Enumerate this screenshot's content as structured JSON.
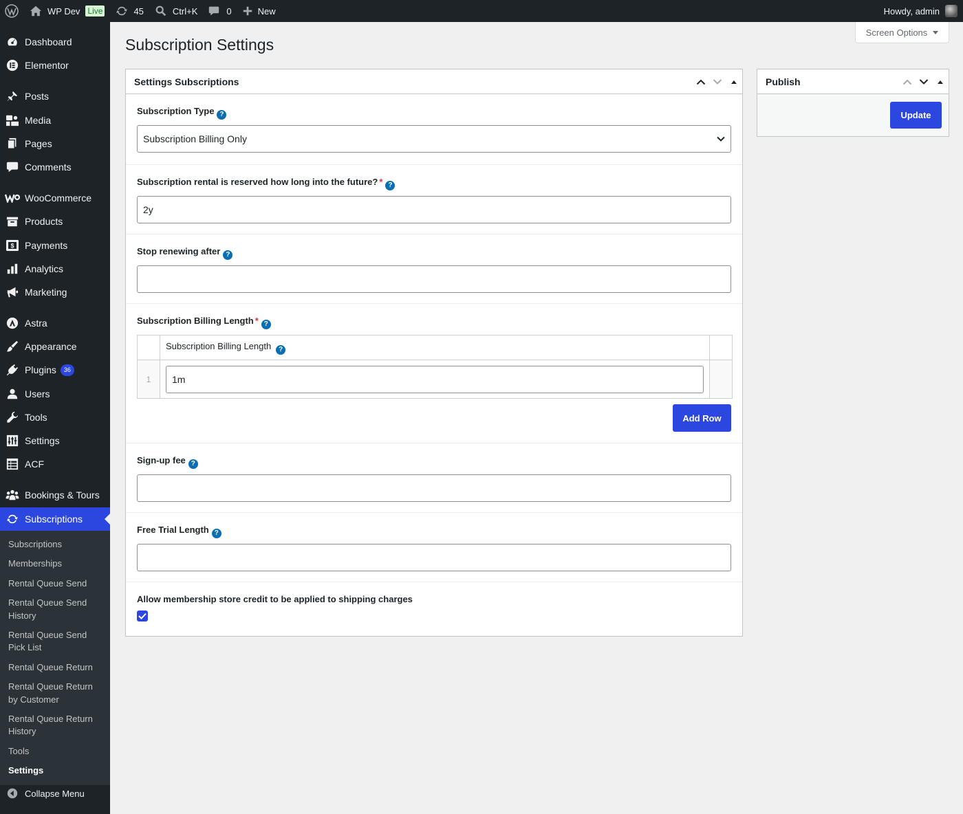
{
  "admin_bar": {
    "site_name": "WP Dev",
    "live_badge": "Live",
    "updates_count": "45",
    "search_shortcut": "Ctrl+K",
    "comments_count": "0",
    "new_label": "New",
    "greeting": "Howdy, admin"
  },
  "sidebar": {
    "items": [
      {
        "label": "Dashboard",
        "icon": "dashboard-icon"
      },
      {
        "label": "Elementor",
        "icon": "elementor-icon"
      },
      {
        "label": "Posts",
        "icon": "pin-icon"
      },
      {
        "label": "Media",
        "icon": "media-icon"
      },
      {
        "label": "Pages",
        "icon": "pages-icon"
      },
      {
        "label": "Comments",
        "icon": "comment-icon"
      },
      {
        "label": "WooCommerce",
        "icon": "woocommerce-icon"
      },
      {
        "label": "Products",
        "icon": "archive-icon"
      },
      {
        "label": "Payments",
        "icon": "payments-icon"
      },
      {
        "label": "Analytics",
        "icon": "bar-chart-icon"
      },
      {
        "label": "Marketing",
        "icon": "megaphone-icon"
      },
      {
        "label": "Astra",
        "icon": "astra-icon"
      },
      {
        "label": "Appearance",
        "icon": "brush-icon"
      },
      {
        "label": "Plugins",
        "icon": "plug-icon",
        "badge": "36"
      },
      {
        "label": "Users",
        "icon": "user-icon"
      },
      {
        "label": "Tools",
        "icon": "wrench-icon"
      },
      {
        "label": "Settings",
        "icon": "sliders-icon"
      },
      {
        "label": "ACF",
        "icon": "grid-icon"
      },
      {
        "label": "Bookings & Tours",
        "icon": "groups-icon"
      },
      {
        "label": "Subscriptions",
        "icon": "update-icon"
      }
    ],
    "submenu": [
      "Subscriptions",
      "Memberships",
      "Rental Queue Send",
      "Rental Queue Send History",
      "Rental Queue Send Pick List",
      "Rental Queue Return",
      "Rental Queue Return by Customer",
      "Rental Queue Return History",
      "Tools",
      "Settings"
    ],
    "collapse_label": "Collapse Menu"
  },
  "screen_options": "Screen Options",
  "page_title": "Subscription Settings",
  "settings_box": {
    "title": "Settings Subscriptions",
    "subscription_type": {
      "label": "Subscription Type",
      "value": "Subscription Billing Only"
    },
    "reserved": {
      "label": "Subscription rental is reserved how long into the future?",
      "required": "*",
      "value": "2y"
    },
    "stop_renewing": {
      "label": "Stop renewing after",
      "value": ""
    },
    "billing_length": {
      "label": "Subscription Billing Length",
      "required": "*",
      "column_header": "Subscription Billing Length",
      "rows": [
        {
          "num": "1",
          "value": "1m"
        }
      ],
      "add_row": "Add Row"
    },
    "signup_fee": {
      "label": "Sign-up fee",
      "value": ""
    },
    "free_trial": {
      "label": "Free Trial Length",
      "value": ""
    },
    "store_credit": {
      "label": "Allow membership store credit to be applied to shipping charges",
      "checked": true
    }
  },
  "publish_box": {
    "title": "Publish",
    "update_label": "Update"
  },
  "colors": {
    "accent": "#2c46e0",
    "admin_bar": "#1d2327",
    "help": "#0a6eb3",
    "required": "#d63638"
  }
}
